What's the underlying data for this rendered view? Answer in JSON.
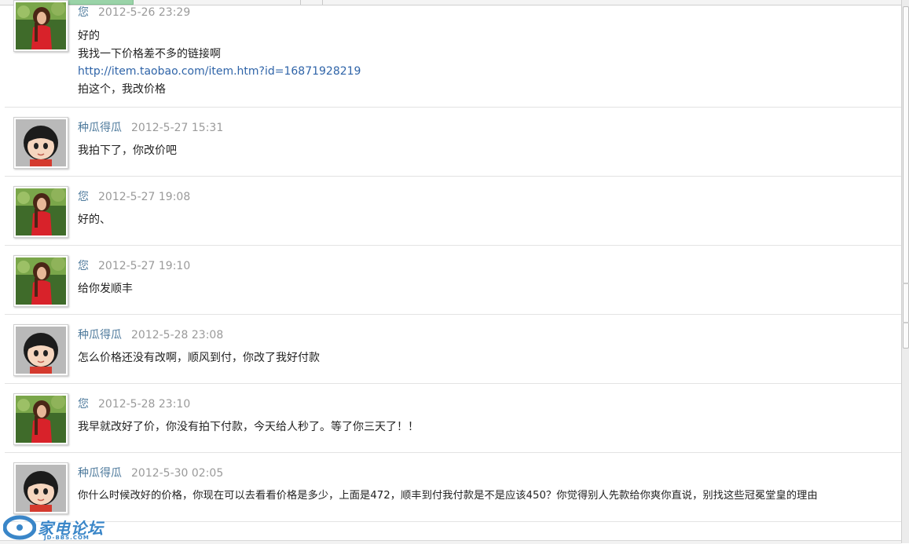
{
  "messages": [
    {
      "sender": "您",
      "time": "2012-5-26 23:29",
      "avatar": "photo-avatar",
      "lines": [
        "好的",
        "我找一下价格差不多的链接啊",
        "http://item.taobao.com/item.htm?id=16871928219",
        "拍这个，我改价格"
      ]
    },
    {
      "sender": "种瓜得瓜",
      "time": "2012-5-27 15:31",
      "avatar": "cartoon-avatar",
      "lines": [
        "我拍下了，你改价吧"
      ]
    },
    {
      "sender": "您",
      "time": "2012-5-27 19:08",
      "avatar": "photo-avatar",
      "lines": [
        "好的、"
      ]
    },
    {
      "sender": "您",
      "time": "2012-5-27 19:10",
      "avatar": "photo-avatar",
      "lines": [
        "给你发顺丰"
      ]
    },
    {
      "sender": "种瓜得瓜",
      "time": "2012-5-28 23:08",
      "avatar": "cartoon-avatar",
      "lines": [
        "怎么价格还没有改啊，顺风到付，你改了我好付款"
      ]
    },
    {
      "sender": "您",
      "time": "2012-5-28 23:10",
      "avatar": "photo-avatar",
      "lines": [
        "我早就改好了价，你没有拍下付款，今天给人秒了。等了你三天了！！"
      ]
    },
    {
      "sender": "种瓜得瓜",
      "time": "2012-5-30 02:05",
      "avatar": "cartoon-avatar",
      "lines": [
        "你什么时候改好的价格，你现在可以去看看价格是多少，上面是472，顺丰到付我付款是不是应该450？你觉得别人先款给你爽你直说，别找这些冠冕堂皇的理由"
      ]
    }
  ],
  "watermark": {
    "title": "家电论坛",
    "subtitle": "JD-BBS.COM",
    "icon": "forum-logo-icon"
  },
  "colors": {
    "sender": "#4e7a9c",
    "time": "#9a9a9a",
    "link": "#2f64a8",
    "divider": "#e3e3e3"
  }
}
